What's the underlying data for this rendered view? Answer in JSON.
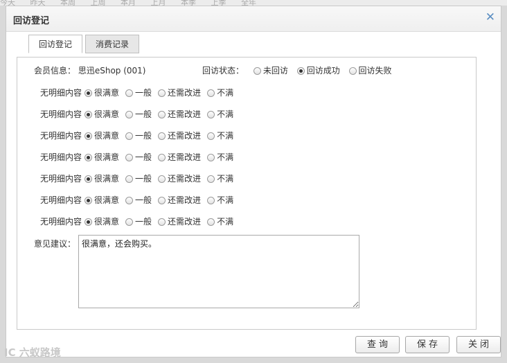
{
  "background_tabs": [
    "今天",
    "昨天",
    "本周",
    "上周",
    "本月",
    "上月",
    "本季",
    "上季",
    "全年"
  ],
  "dialog": {
    "title": "回访登记",
    "close_icon": "close-icon"
  },
  "tabs": [
    {
      "label": "回访登记",
      "active": true
    },
    {
      "label": "消费记录",
      "active": false
    }
  ],
  "member": {
    "label": "会员信息：",
    "value": "思迅eShop (001)"
  },
  "visit_status": {
    "label": "回访状态：",
    "options": [
      "未回访",
      "回访成功",
      "回访失败"
    ],
    "selected": "回访成功"
  },
  "detail_label": "无明细内容",
  "rating_options": [
    "很满意",
    "一般",
    "还需改进",
    "不满"
  ],
  "ratings_selected": [
    "很满意",
    "很满意",
    "很满意",
    "很满意",
    "很满意",
    "很满意",
    "很满意"
  ],
  "suggestion": {
    "label": "意见建议：",
    "value": "很满意，还会购买。"
  },
  "buttons": {
    "query": "查询",
    "save": "保存",
    "close": "关闭"
  },
  "watermark": "IC 六蚁路境",
  "colors": {
    "close_icon": "#5b8ec2",
    "panel_border": "#c9c9c9"
  }
}
